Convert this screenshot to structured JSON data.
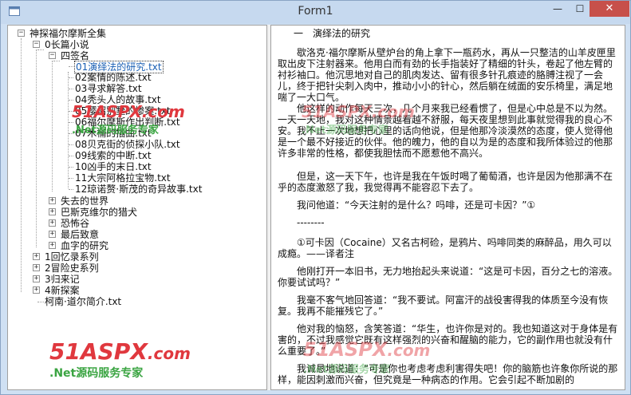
{
  "window": {
    "title": "Form1",
    "controls": {
      "minimize": "—",
      "maximize": "☐",
      "close": "✕"
    }
  },
  "tree": {
    "root": "神探福尔摩斯全集",
    "category_long": "0长篇小说",
    "group_sign_of_four": "四签名",
    "chapters": [
      "01演绎法的研究.txt",
      "02案情的陈述.txt",
      "03寻求解答.txt",
      "04秃头人的故事.txt",
      "05樱沼别墅的惨案.txt",
      "06福尔摩斯作出判断.txt",
      "07木桶的插曲.txt",
      "08贝克街的侦探小队.txt",
      "09线索的中断.txt",
      "10凶手的末日.txt",
      "11大宗阿格拉宝物.txt",
      "12琼诺赘·斯茂的奇异故事.txt"
    ],
    "long_others": [
      "失去的世界",
      "巴斯克维尔的猎犬",
      "恐怖谷",
      "最后致意",
      "血字的研究"
    ],
    "top_categories": [
      "1回忆录系列",
      "2冒险史系列",
      "3归来记",
      "4新探案"
    ],
    "bio_file": "柯南·道尔简介.txt"
  },
  "text": {
    "heading": "一　演绎法的研究",
    "paragraphs": [
      "歇洛克·福尔摩斯从壁炉台的角上拿下一瓶药水，再从一只整洁的山羊皮匣里取出皮下注射器来。他用白而有劲的长手指装好了精细的针头，卷起了他左臂的衬衫袖口。他沉思地对自己的肌肉发达、留有很多针孔痕迹的胳膊注视了一会儿，终于把针尖刺入肉中，推动小小的针心，然后躺在绒面的安乐椅里，满足地喘了一大口气。",
      "他这样的动作每天三次，几个月来我已经看惯了，但是心中总是不以为然。一天一天地，我对这种情景越看越不舒服，每天夜里想到此事就觉得我的良心不安。我不止一次地想把心里的话向他说，但是他那冷淡漠然的态度，使人觉得他是一个最不好接近的伙伴。他的魄力，他的自以为是的态度和我所体验过的他那许多非常的性格，都使我胆怯而不愿惹他不高兴。",
      "但是，这一天下午，也许是我在午饭时喝了葡萄酒，也许是因为他那满不在乎的态度激怒了我，我觉得再不能容忍下去了。",
      "我问他道：“今天注射的是什么？吗啡，还是可卡因？”①",
      "--------",
      "①可卡因（Cocaine）又名古柯硷，是鸦片、吗啡同类的麻醉品，用久可以成瘾。——译者注",
      "他刚打开一本旧书，无力地抬起头来说道：“这是可卡因，百分之七的溶液。你要试试吗？”",
      "我毫不客气地回答道：“我不要试。阿富汗的战役害得我的体质至今没有恢复。我再不能摧残它了。”",
      "他对我的恼怒，含笑答道：“华生，也许你是对的。我也知道这对于身体是有害的，不过我感觉它既有这样强烈的兴奋和醒脑的能力，它的副作用也就没有什么重要了。”",
      "我诚恳地说道：“可是你也考虑考虑利害得失吧！你的脑筋也许象你所说的那样，能因刺激而兴奋，但究竟是一种病态的作用。它会引起不断加剧的"
    ]
  },
  "watermark": {
    "brand": "51ASPX",
    "domain": ".com",
    "tagline": ".Net源码服务专家"
  }
}
